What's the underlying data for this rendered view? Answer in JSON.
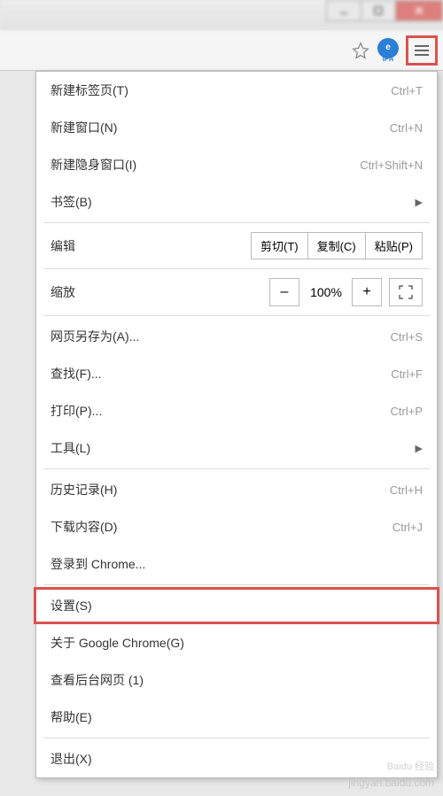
{
  "window_controls": {
    "minimize": "–",
    "maximize": "▢",
    "close": "✕"
  },
  "toolbar": {
    "ipa_label": "IPA",
    "ipa_letter": "e"
  },
  "menu": {
    "new_tab": {
      "label": "新建标签页(T)",
      "shortcut": "Ctrl+T"
    },
    "new_window": {
      "label": "新建窗口(N)",
      "shortcut": "Ctrl+N"
    },
    "incognito": {
      "label": "新建隐身窗口(I)",
      "shortcut": "Ctrl+Shift+N"
    },
    "bookmarks": {
      "label": "书签(B)"
    },
    "edit": {
      "label": "编辑",
      "cut": "剪切(T)",
      "copy": "复制(C)",
      "paste": "粘贴(P)"
    },
    "zoom": {
      "label": "缩放",
      "minus": "–",
      "value": "100%",
      "plus": "+"
    },
    "save_as": {
      "label": "网页另存为(A)...",
      "shortcut": "Ctrl+S"
    },
    "find": {
      "label": "查找(F)...",
      "shortcut": "Ctrl+F"
    },
    "print": {
      "label": "打印(P)...",
      "shortcut": "Ctrl+P"
    },
    "tools": {
      "label": "工具(L)"
    },
    "history": {
      "label": "历史记录(H)",
      "shortcut": "Ctrl+H"
    },
    "downloads": {
      "label": "下载内容(D)",
      "shortcut": "Ctrl+J"
    },
    "sign_in": {
      "label": "登录到 Chrome..."
    },
    "settings": {
      "label": "设置(S)"
    },
    "about": {
      "label": "关于 Google Chrome(G)"
    },
    "background": {
      "label": "查看后台网页 (1)"
    },
    "help": {
      "label": "帮助(E)"
    },
    "exit": {
      "label": "退出(X)"
    }
  },
  "watermark": {
    "logo": "Baidu 经验",
    "url": "jingyan.baidu.com"
  }
}
